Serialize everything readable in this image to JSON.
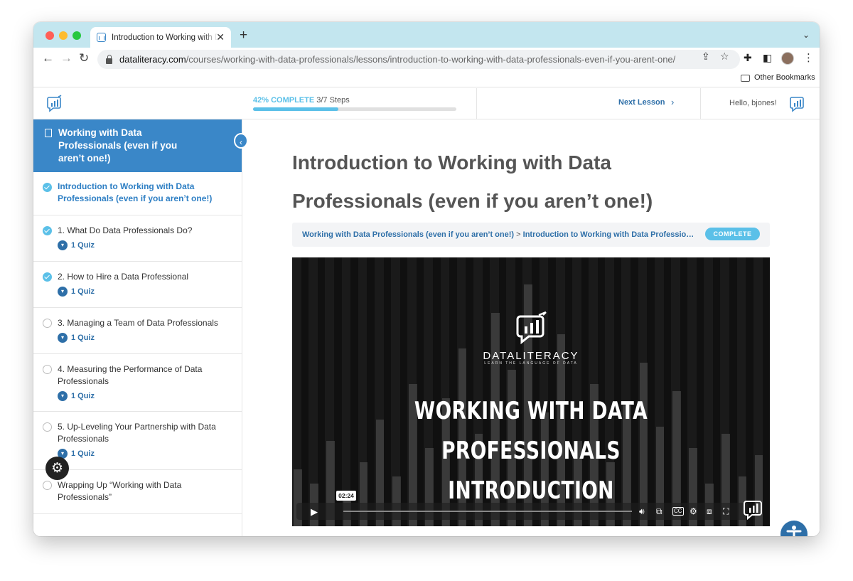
{
  "browser": {
    "tab_title": "Introduction to Working with Data Professionals (even if you aren't one!)",
    "url_domain": "dataliteracy.com",
    "url_path": "/courses/working-with-data-professionals/lessons/introduction-to-working-with-data-professionals-even-if-you-arent-one/",
    "bookmark_folder": "Other Bookmarks"
  },
  "header": {
    "progress_pct_label": "42% COMPLETE",
    "progress_steps": "3/7 Steps",
    "progress_fraction": 0.42,
    "next_lesson": "Next Lesson",
    "greeting": "Hello, bjones!"
  },
  "sidebar": {
    "course_title": "Working with Data Professionals (even if you aren’t one!)",
    "lessons": [
      {
        "title": "Introduction to Working with Data Professionals (even if you aren’t one!)",
        "status": "complete",
        "active": true,
        "quiz": ""
      },
      {
        "title": "1. What Do Data Professionals Do?",
        "status": "complete",
        "active": false,
        "quiz": "1 Quiz"
      },
      {
        "title": "2. How to Hire a Data Professional",
        "status": "complete",
        "active": false,
        "quiz": "1 Quiz"
      },
      {
        "title": "3. Managing a Team of Data Professionals",
        "status": "incomplete",
        "active": false,
        "quiz": "1 Quiz"
      },
      {
        "title": "4. Measuring the Performance of Data Professionals",
        "status": "incomplete",
        "active": false,
        "quiz": "1 Quiz"
      },
      {
        "title": "5. Up-Leveling Your Partnership with Data Professionals",
        "status": "incomplete",
        "active": false,
        "quiz": "1 Quiz"
      },
      {
        "title": "Wrapping Up “Working with Data Professionals”",
        "status": "incomplete",
        "active": false,
        "quiz": ""
      }
    ]
  },
  "main": {
    "title": "Introduction to Working with Data Professionals (even if you aren’t one!)",
    "breadcrumb_course": "Working with Data Professionals (even if you aren’t one!)",
    "breadcrumb_separator": ">",
    "breadcrumb_lesson": "Introduction to Working with Data Professionals (even if you aren’t one!)",
    "status_badge": "COMPLETE"
  },
  "video": {
    "brand": "DATALITERACY",
    "brand_tagline": "LEARN THE LANGUAGE OF DATA",
    "title_line1": "WORKING WITH DATA PROFESSIONALS",
    "title_line2": "INTRODUCTION",
    "timestamp": "02:24"
  },
  "colors": {
    "accent_blue": "#3a87c8",
    "progress_cyan": "#5bc0e8",
    "link_blue": "#2e6fa8"
  }
}
